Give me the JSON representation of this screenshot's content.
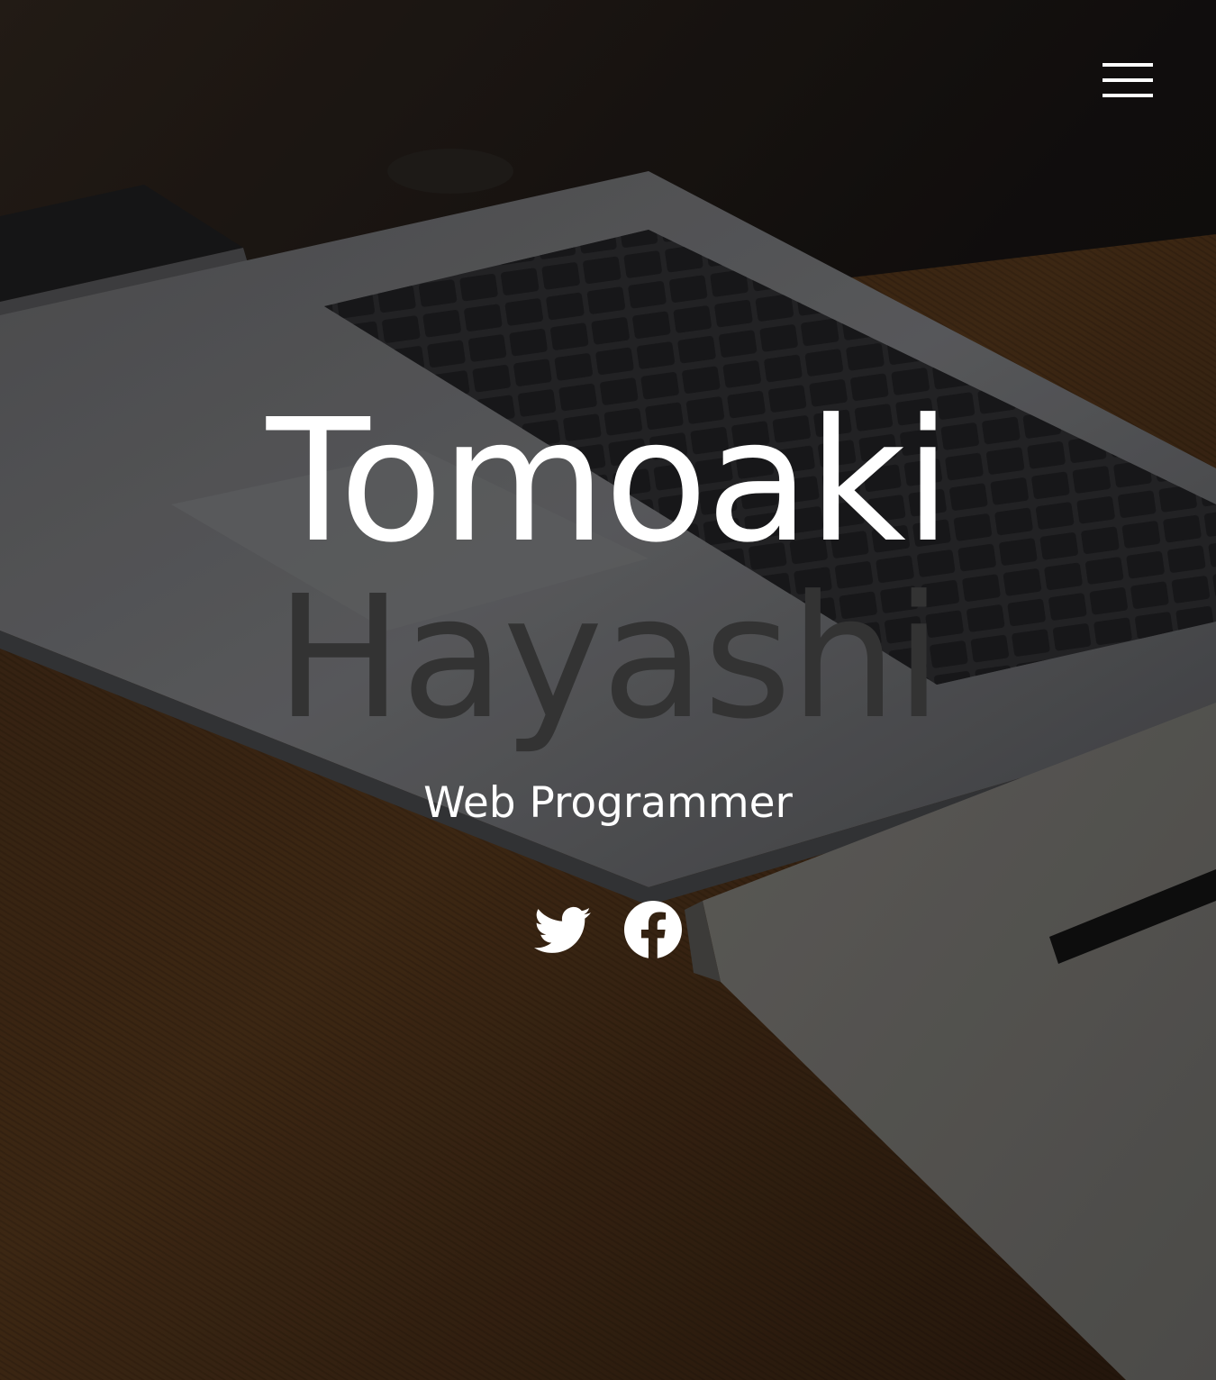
{
  "hero": {
    "first_name": "Tomoaki",
    "last_name": "Hayashi",
    "role": "Web Programmer"
  },
  "header": {
    "menu_icon": "hamburger-menu-icon"
  },
  "social": [
    {
      "icon": "twitter-icon"
    },
    {
      "icon": "facebook-icon"
    }
  ],
  "colors": {
    "text_primary": "#ffffff",
    "last_name": "#333333",
    "overlay": "#000000"
  }
}
